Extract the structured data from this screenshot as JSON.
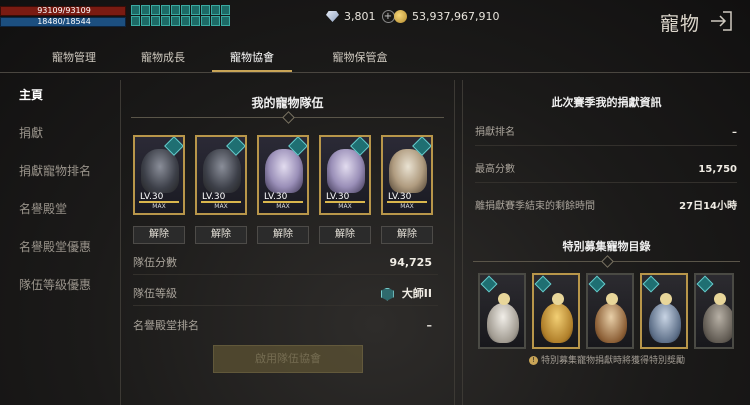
{
  "hud": {
    "hp": "93109/93109",
    "mp": "18480/18544",
    "diamonds": "3,801",
    "gold": "53,937,967,910",
    "page_title": "寵物"
  },
  "tabs": [
    "寵物管理",
    "寵物成長",
    "寵物協會",
    "寵物保管盒"
  ],
  "active_tab": "寵物協會",
  "sidenav": [
    "主頁",
    "捐獻",
    "捐獻寵物排名",
    "名譽殿堂",
    "名譽殿堂優惠",
    "隊伍等級優惠"
  ],
  "team": {
    "heading": "我的寵物隊伍",
    "pets": [
      {
        "level": "LV.30",
        "max": "MAX",
        "remove": "解除"
      },
      {
        "level": "LV.30",
        "max": "MAX",
        "remove": "解除"
      },
      {
        "level": "LV.30",
        "max": "MAX",
        "remove": "解除"
      },
      {
        "level": "LV.30",
        "max": "MAX",
        "remove": "解除"
      },
      {
        "level": "LV.30",
        "max": "MAX",
        "remove": "解除"
      }
    ],
    "stats": [
      {
        "label": "隊伍分數",
        "value": "94,725"
      },
      {
        "label": "隊伍等級",
        "value": "大師II"
      },
      {
        "label": "名譽殿堂排名",
        "value": "–"
      }
    ],
    "apply_button": "啟用隊伍協會"
  },
  "season": {
    "heading": "此次賽季我的捐獻資訊",
    "rows": [
      {
        "label": "捐獻排名",
        "value": "–"
      },
      {
        "label": "最高分數",
        "value": "15,750"
      },
      {
        "label": "離捐獻賽季結束的剩餘時間",
        "value": "27日14小時"
      }
    ]
  },
  "recruit": {
    "heading": "特別募集寵物目錄",
    "note": "特別募集寵物捐獻時將獲得特別獎勵"
  }
}
